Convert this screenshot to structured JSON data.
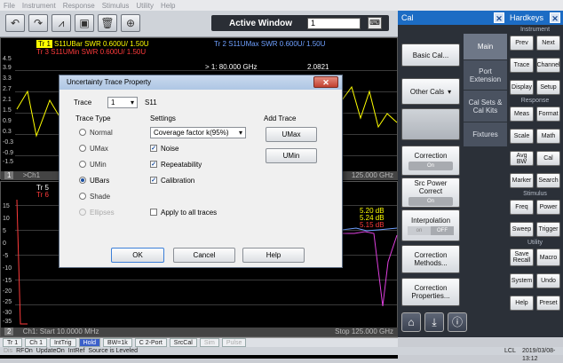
{
  "menu": [
    "File",
    "Instrument",
    "Response",
    "Stimulus",
    "Utility",
    "Help"
  ],
  "toolbar": {
    "active_window_label": "Active Window",
    "active_window_value": "1"
  },
  "plot": {
    "upper": {
      "trace1_label": "Tr 1",
      "trace1_desc": "S11UBar SWR 0.600U/  1.50U",
      "trace2_desc": "Tr 2  S11UMax SWR 0.600U/  1.50U",
      "trace3_desc": "Tr 3  S11UMin SWR 0.600U/  1.50U",
      "marker": "> 1:   80.000  GHz",
      "marker_value": "2.0821",
      "yticks": [
        "4.5",
        "3.9",
        "3.3",
        "2.7",
        "2.1",
        "1.5",
        "0.9",
        "0.3",
        "-0.3",
        "-0.9",
        "-1.5"
      ],
      "channel_num": "1",
      "start": ">Ch1",
      "stop": "125.000 GHz"
    },
    "lower": {
      "trace5_label": "Tr 5",
      "trace6_label": "Tr 6",
      "marker_values": [
        "5.20 dB",
        "5.24 dB",
        "5.15 dB"
      ],
      "yticks": [
        "15",
        "10",
        "5",
        "0",
        "-5",
        "-10",
        "-15",
        "-20",
        "-25",
        "-30",
        "-35"
      ],
      "channel_num": "2",
      "start": "Ch1: Start  10.0000 MHz",
      "stop": "Stop  125.000 GHz"
    }
  },
  "statusbar": {
    "items": [
      "Tr 1",
      "Ch 1",
      "IntTrig",
      "Hold",
      "BW=1k",
      "C 2-Port",
      "SrcCal",
      "Sim",
      "Pulse"
    ],
    "row2": [
      "Dis",
      "RFOn",
      "UpdateOn",
      "IntRef",
      "Source is Leveled"
    ],
    "lcl": "LCL",
    "datetime": "2019/03/08-13:12"
  },
  "cal_panel": {
    "title": "Cal",
    "buttons": {
      "basic_cal": "Basic Cal...",
      "other_cals": "Other Cals",
      "correction": "Correction",
      "correction_state": "On",
      "src_power_correct": "Src Power Correct",
      "src_power_state": "On",
      "interpolation": "Interpolation",
      "interpolation_on": "on",
      "interpolation_off": "OFF",
      "correction_methods": "Correction Methods...",
      "correction_properties": "Correction Properties..."
    },
    "tabs": [
      "Main",
      "Port Extension",
      "Cal Sets & Cal Kits",
      "Fixtures"
    ]
  },
  "hardkeys": {
    "title": "Hardkeys",
    "sections": {
      "instrument": "Instrument",
      "response": "Response",
      "stimulus": "Stimulus",
      "utility": "Utility"
    },
    "keys": {
      "prev": "Prev",
      "next": "Next",
      "trace": "Trace",
      "channel": "Channel",
      "display": "Display",
      "setup": "Setup",
      "meas": "Meas",
      "format": "Format",
      "scale": "Scale",
      "math": "Math",
      "avg_bw": "Avg BW",
      "cal": "Cal",
      "marker": "Marker",
      "search": "Search",
      "freq": "Freq",
      "power": "Power",
      "sweep": "Sweep",
      "trigger": "Trigger",
      "save_recall": "Save Recall",
      "macro": "Macro",
      "system": "System",
      "undo": "Undo",
      "help": "Help",
      "preset": "Preset"
    }
  },
  "dialog": {
    "title": "Uncertainty Trace Property",
    "trace_label": "Trace",
    "trace_value": "1",
    "trace_param": "S11",
    "trace_type_heading": "Trace Type",
    "trace_types": [
      "Normal",
      "UMax",
      "UMin",
      "UBars",
      "Shade",
      "Ellipses"
    ],
    "selected_type": "UBars",
    "settings_heading": "Settings",
    "coverage_factor": "Coverage factor k(95%)",
    "noise": "Noise",
    "repeatability": "Repeatability",
    "calibration": "Calibration",
    "apply_all": "Apply to all traces",
    "add_trace_heading": "Add Trace",
    "umax_button": "UMax",
    "umin_button": "UMin",
    "ok": "OK",
    "cancel": "Cancel",
    "help": "Help"
  },
  "colors": {
    "trace_yellow": "#ffff00",
    "trace_blue": "#6fa0ff",
    "trace_red": "#ff3b3b",
    "trace_magenta": "#e040e0",
    "accent_blue": "#1c6cc4"
  }
}
